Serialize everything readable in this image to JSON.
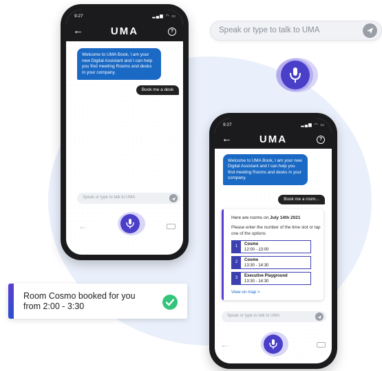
{
  "top_search": {
    "placeholder": "Speak or type to talk to UMA",
    "send_icon": "send-icon",
    "mic_icon": "mic-icon"
  },
  "phone_left": {
    "status_time": "9:27",
    "status_icons": "▂▄▆ ◠ ▭",
    "logo": "UMA",
    "back_icon": "←",
    "help_icon": "?",
    "bot_message": "Welcome to UMA Book, I am your new Digital Assistant and I can help you find meeting Rooms and desks in your company.",
    "user_message": "Book me a desk",
    "input_placeholder": "Speak or type to talk to UMA",
    "bottom_back": "←"
  },
  "phone_right": {
    "status_time": "9:27",
    "status_icons": "▂▄▆ ◠ ▭",
    "logo": "UMA",
    "back_icon": "←",
    "help_icon": "?",
    "bot_message": "Welcome to UMA Book, I am your new Digital Assistant and I can help you find meeting Rooms and desks in your company.",
    "user_message": "Book me a room...",
    "rooms": {
      "intro_prefix": "Here are rooms on ",
      "intro_date": "July 14th 2021",
      "instruction": "Please enter the number of the time slot or tap one of the options",
      "options": [
        {
          "num": "1",
          "name": "Cosmo",
          "time": "12:00 - 13:00"
        },
        {
          "num": "2",
          "name": "Cosmo",
          "time": "13:30 - 14:30"
        },
        {
          "num": "3",
          "name": "Executive Playground",
          "time": "13:30 - 14:30"
        }
      ],
      "view_map": "View on map  >"
    },
    "input_placeholder": "Speak or type to talk to UMA",
    "bottom_back": "←"
  },
  "toast": {
    "message": "Room Cosmo booked for you from 2:00 - 3:30",
    "icon": "check-icon"
  },
  "colors": {
    "brand_blue": "#1a69c4",
    "accent_purple": "#5b3fd0",
    "success_green": "#35c47c",
    "dark": "#1b1b1d"
  }
}
